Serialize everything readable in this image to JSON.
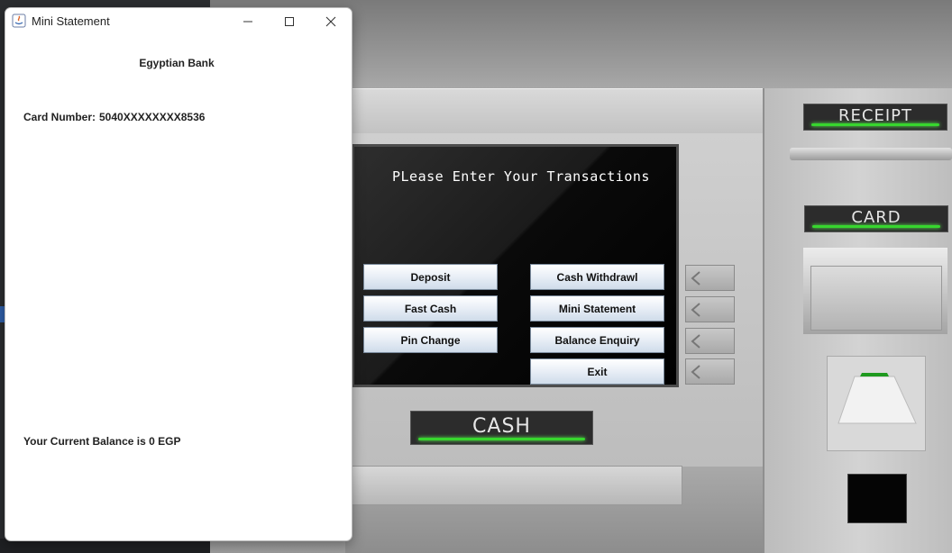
{
  "dialog": {
    "window_title": "Mini Statement",
    "bank_name": "Egyptian Bank",
    "card_label": "Card Number:",
    "card_number": "5040XXXXXXXX8536",
    "balance_text": "Your Current Balance is 0 EGP"
  },
  "atm": {
    "screen_title": "PLease Enter Your Transactions",
    "buttons": {
      "deposit": "Deposit",
      "cash_withdrawl": "Cash Withdrawl",
      "fast_cash": "Fast Cash",
      "mini_statement": "Mini Statement",
      "pin_change": "Pin Change",
      "balance_enquiry": "Balance Enquiry",
      "exit": "Exit"
    },
    "labels": {
      "receipt": "RECEIPT",
      "card": "CARD",
      "cash": "CASH"
    }
  },
  "colors": {
    "indicator_green": "#37d62e",
    "button_gradient_end": "#cfdcea"
  }
}
